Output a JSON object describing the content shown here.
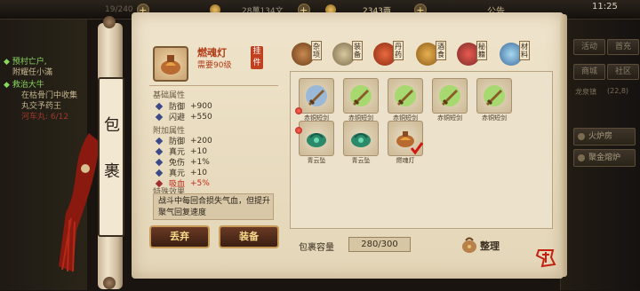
{
  "topbar": {
    "resource_1": "19/240",
    "resource_2": "28萬134文",
    "resource_3": "2343两",
    "announcement": "公告",
    "time": "11:25"
  },
  "quests": {
    "q1_title": "◆ 预村亡户,",
    "q1_desc": "附耀任小滿",
    "q2_title": "◆ 救治大牛",
    "q2_line1": "在枯骨门中收集",
    "q2_line2": "丸交予药王",
    "q2_progress": "河车丸: 6/12"
  },
  "scroll": {
    "title_char_1": "包",
    "title_char_2": "裹"
  },
  "item_detail": {
    "name": "燃魂灯",
    "requirement": "需要90级",
    "equipped_badge": "挂件",
    "base_section": "基础属性",
    "base_attrs": [
      {
        "label": "防御",
        "value": "+900"
      },
      {
        "label": "闪避",
        "value": "+550"
      }
    ],
    "extra_section": "附加属性",
    "extra_attrs": [
      {
        "label": "防御",
        "value": "+200"
      },
      {
        "label": "真元",
        "value": "+10"
      },
      {
        "label": "免伤",
        "value": "+1%"
      },
      {
        "label": "真元",
        "value": "+10"
      },
      {
        "label": "吸血",
        "value": "+5%"
      }
    ],
    "special_section": "特殊效果",
    "special_text": "战斗中每回合损失气血，但提升聚气回复速度"
  },
  "buttons": {
    "discard": "丢弃",
    "equip": "装备",
    "sort": "整理"
  },
  "tabs": [
    {
      "label": "杂项",
      "icon": "misc-bag-icon"
    },
    {
      "label": "装备",
      "icon": "equipment-icon"
    },
    {
      "label": "丹药",
      "icon": "medicine-icon"
    },
    {
      "label": "酒食",
      "icon": "food-icon"
    },
    {
      "label": "秘籍",
      "icon": "book-icon"
    },
    {
      "label": "材料",
      "icon": "material-icon"
    }
  ],
  "items": [
    {
      "name": "赤铜短剑",
      "icon": "sword-icon",
      "new": true
    },
    {
      "name": "赤铜短剑",
      "icon": "sword-icon",
      "new": false
    },
    {
      "name": "赤铜短剑",
      "icon": "sword-icon",
      "new": false
    },
    {
      "name": "赤铜短剑",
      "icon": "sword-icon",
      "new": false
    },
    {
      "name": "赤铜短剑",
      "icon": "sword-icon",
      "new": false
    },
    {
      "name": "青云坠",
      "icon": "pendant-icon",
      "new": true
    },
    {
      "name": "青云坠",
      "icon": "pendant-icon",
      "new": false
    },
    {
      "name": "燃魂灯",
      "icon": "lamp-icon",
      "new": false,
      "selected": true
    }
  ],
  "capacity": {
    "label": "包裹容量",
    "value": "280/300"
  },
  "rightpane": {
    "btn1": "活动",
    "btn2": "首充",
    "btn3": "商城",
    "btn4": "社区",
    "info": "龙泉镇",
    "coords": "(22,8)",
    "action1": "火炉房",
    "action2": "聚金熔炉"
  },
  "stamp": "乐游"
}
